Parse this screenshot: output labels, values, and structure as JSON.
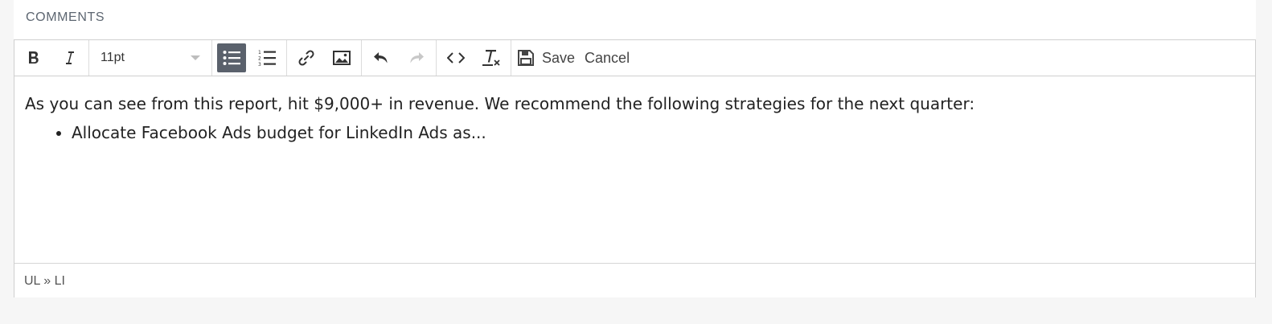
{
  "section": {
    "label": "COMMENTS"
  },
  "toolbar": {
    "font_size": "11pt",
    "save_label": "Save",
    "cancel_label": "Cancel",
    "icons": [
      "bold-icon",
      "italic-icon",
      "bullet-list-icon",
      "numbered-list-icon",
      "link-icon",
      "image-icon",
      "undo-icon",
      "redo-icon",
      "code-icon",
      "clear-format-icon",
      "save-icon"
    ]
  },
  "editor": {
    "paragraph": "As you can see from this report, hit $9,000+ in revenue. We recommend the following strategies for the next quarter:",
    "list_items": [
      "Allocate Facebook Ads budget for LinkedIn Ads as..."
    ]
  },
  "statusbar": {
    "path": "UL » LI"
  },
  "colors": {
    "active_button": "#5a616c",
    "page_background": "#f6f6f6",
    "border": "#cfcfcf"
  }
}
